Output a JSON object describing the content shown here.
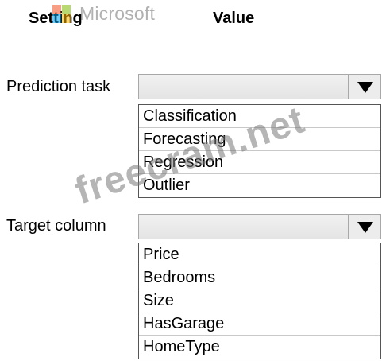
{
  "header": {
    "setting_label": "Setting",
    "value_label": "Value"
  },
  "logo": {
    "text": "Microsoft",
    "colors": [
      "#f25022",
      "#7fba00",
      "#00a4ef",
      "#ffb900"
    ]
  },
  "watermark": {
    "text": "freecram.net"
  },
  "prediction_task": {
    "label": "Prediction task",
    "selected": "",
    "options": [
      "Classification",
      "Forecasting",
      "Regression",
      "Outlier"
    ]
  },
  "target_column": {
    "label": "Target column",
    "selected": "",
    "options": [
      "Price",
      "Bedrooms",
      "Size",
      "HasGarage",
      "HomeType"
    ]
  },
  "icons": {
    "dropdown_arrow": "triangle-down-icon"
  }
}
